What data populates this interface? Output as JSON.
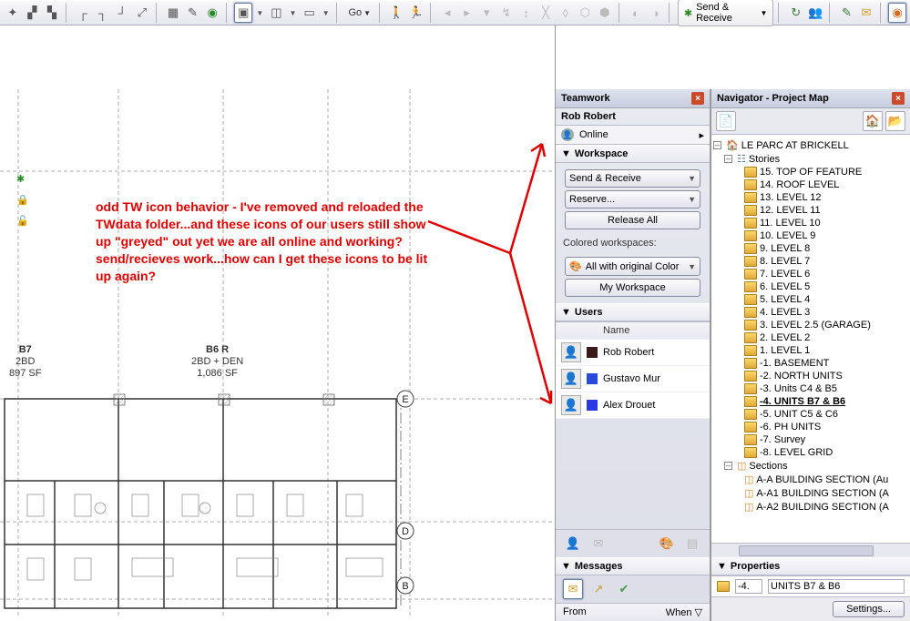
{
  "toolbar": {
    "go_label": "Go",
    "send_receive_label": "Send & Receive"
  },
  "annotation_text": "odd TW icon behavior - I've removed and reloaded the TWdata folder...and these icons of our users still show up \"greyed\" out yet we are all online and working? send/recieves work...how can I get these icons to be lit up again?",
  "canvas_labels": {
    "b7_title": "B7",
    "b7_line2": "2BD",
    "b7_line3": "897 SF",
    "b6r_title": "B6 R",
    "b6r_line2": "2BD + DEN",
    "b6r_line3": "1,086 SF"
  },
  "teamwork": {
    "title": "Teamwork",
    "username": "Rob Robert",
    "status": "Online",
    "workspace_header": "Workspace",
    "send_receive_btn": "Send & Receive",
    "reserve_btn": "Reserve...",
    "release_btn": "Release All",
    "colored_label": "Colored workspaces:",
    "color_dropdown": "All with original Color",
    "my_workspace_btn": "My Workspace",
    "users_header": "Users",
    "name_col": "Name",
    "users": [
      {
        "name": "Rob Robert",
        "swatch": "#3a1a1a"
      },
      {
        "name": "Gustavo Mur",
        "swatch": "#2a4ad8"
      },
      {
        "name": "Alex Drouet",
        "swatch": "#2a3ae0"
      }
    ],
    "messages_header": "Messages",
    "from_col": "From",
    "when_col": "When"
  },
  "navigator": {
    "title": "Navigator - Project Map",
    "project": "LE PARC AT BRICKELL",
    "stories_label": "Stories",
    "stories": [
      "15. TOP OF FEATURE",
      "14. ROOF LEVEL",
      "13. LEVEL 12",
      "12. LEVEL 11",
      "11. LEVEL 10",
      "10. LEVEL 9",
      "9. LEVEL 8",
      "8. LEVEL 7",
      "7. LEVEL 6",
      "6. LEVEL 5",
      "5. LEVEL 4",
      "4. LEVEL 3",
      "3. LEVEL 2.5 (GARAGE)",
      "2. LEVEL 2",
      "1. LEVEL 1",
      "-1. BASEMENT",
      "-2. NORTH UNITS",
      "-3. Units C4 & B5",
      "-4. UNITS B7 & B6",
      "-5. UNIT C5 & C6",
      "-6. PH UNITS",
      "-7. Survey",
      "-8. LEVEL GRID"
    ],
    "sections_label": "Sections",
    "sections": [
      "A-A BUILDING SECTION (Au",
      "A-A1 BUILDING SECTION (A",
      "A-A2 BUILDING SECTION (A"
    ],
    "properties_header": "Properties",
    "prop_index": "-4.",
    "prop_value": "UNITS B7 & B6",
    "settings_btn": "Settings..."
  }
}
